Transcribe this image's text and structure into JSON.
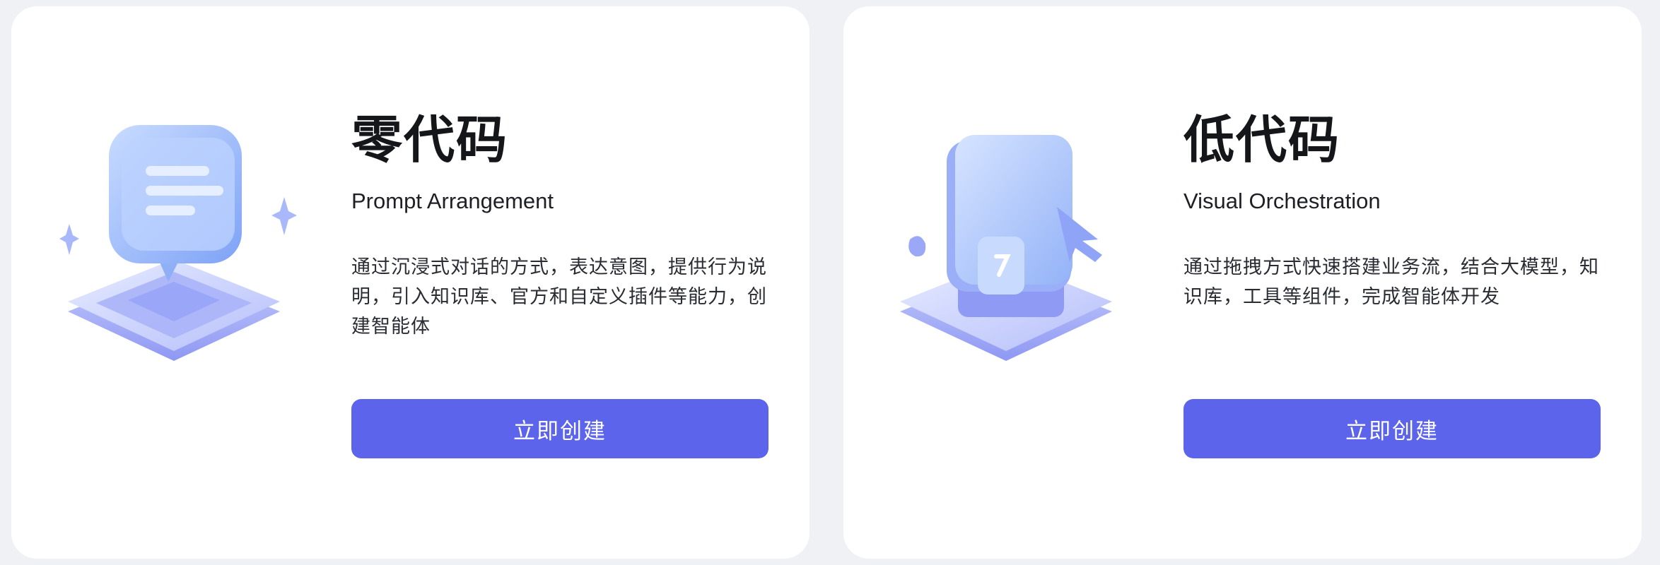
{
  "cards": [
    {
      "title": "零代码",
      "subtitle": "Prompt Arrangement",
      "description": "通过沉浸式对话的方式，表达意图，提供行为说明，引入知识库、官方和自定义插件等能力，创建智能体",
      "button_label": "立即创建",
      "illustration_icon": "chat-bubble-icon"
    },
    {
      "title": "低代码",
      "subtitle": "Visual Orchestration",
      "description": "通过拖拽方式快速搭建业务流，结合大模型，知识库，工具等组件，完成智能体开发",
      "button_label": "立即创建",
      "illustration_icon": "drag-cursor-icon"
    }
  ],
  "colors": {
    "background": "#f0f1f5",
    "card": "#ffffff",
    "accent": "#5b64ea"
  }
}
